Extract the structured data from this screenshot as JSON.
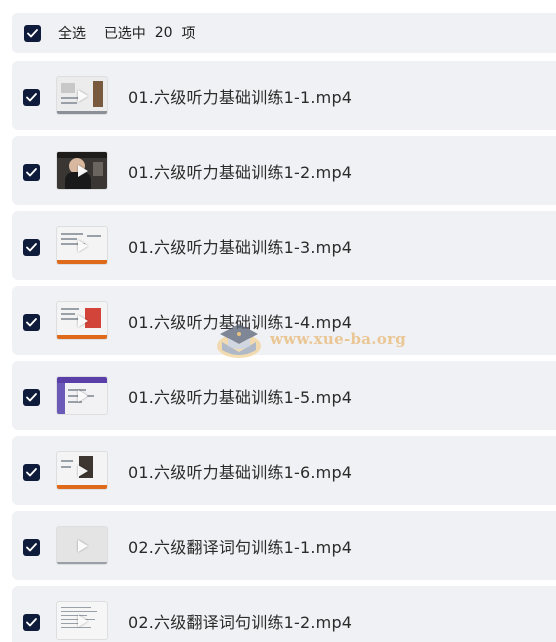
{
  "header": {
    "select_all_label": "全选",
    "selected_prefix": "已选中",
    "selected_count": "20",
    "selected_suffix": "项"
  },
  "files": [
    {
      "name": "01.六级听力基础训练1-1.mp4",
      "thumb": "slide-photo"
    },
    {
      "name": "01.六级听力基础训练1-2.mp4",
      "thumb": "person"
    },
    {
      "name": "01.六级听力基础训练1-3.mp4",
      "thumb": "slide-orange"
    },
    {
      "name": "01.六级听力基础训练1-4.mp4",
      "thumb": "slide-red"
    },
    {
      "name": "01.六级听力基础训练1-5.mp4",
      "thumb": "slide-purple"
    },
    {
      "name": "01.六级听力基础训练1-6.mp4",
      "thumb": "slide-orange-photo"
    },
    {
      "name": "02.六级翻译词句训练1-1.mp4",
      "thumb": "blank-gray"
    },
    {
      "name": "02.六级翻译词句训练1-2.mp4",
      "thumb": "text-doc"
    }
  ],
  "watermark": {
    "text": "www.xue-ba.org"
  },
  "colors": {
    "row_bg": "#f0f1f4",
    "checkbox": "#0f1b3a",
    "thumb_bar": "#e06a1b",
    "watermark": "#e8b874"
  }
}
